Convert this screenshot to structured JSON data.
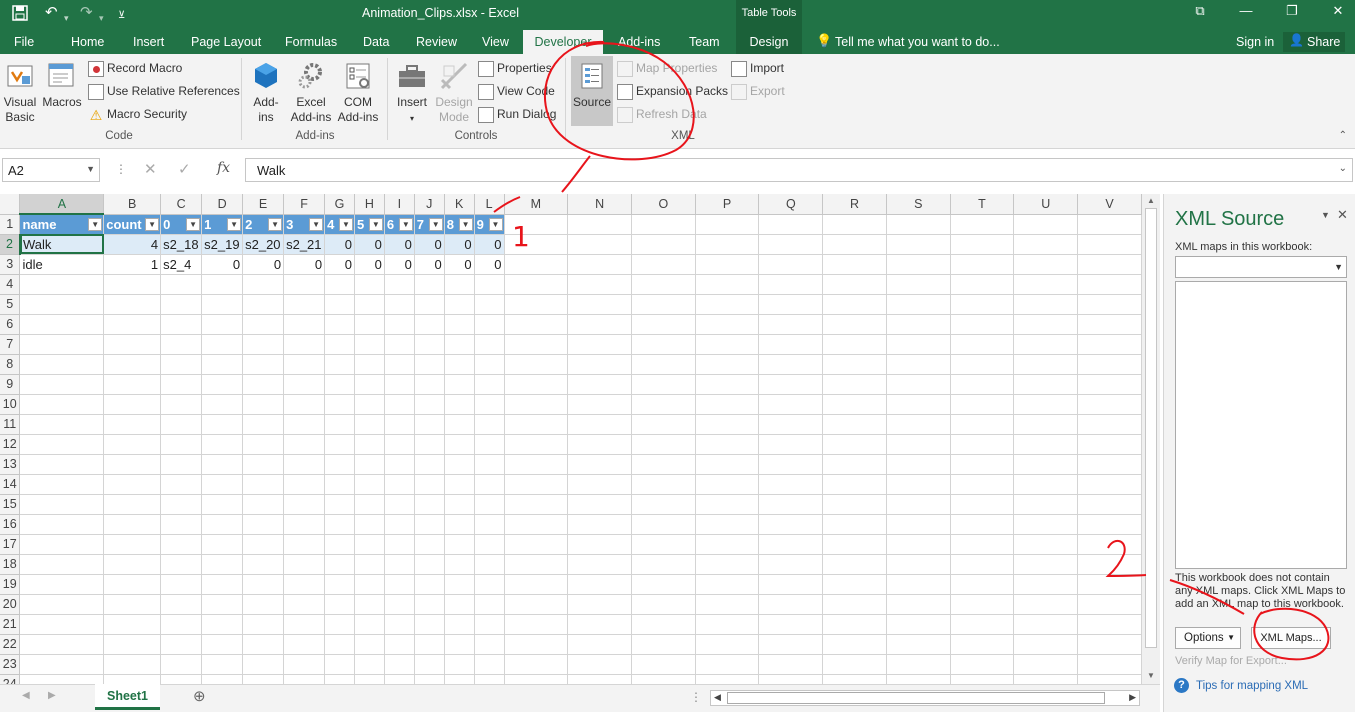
{
  "window": {
    "title": "Animation_Clips.xlsx - Excel",
    "context_group": "Table Tools",
    "signin": "Sign in",
    "share": "Share",
    "tell_me": "Tell me what you want to do..."
  },
  "tabs": [
    "File",
    "Home",
    "Insert",
    "Page Layout",
    "Formulas",
    "Data",
    "Review",
    "View",
    "Developer",
    "Add-ins",
    "Team",
    "Design"
  ],
  "ribbon": {
    "code": {
      "label": "Code",
      "visual_basic_1": "Visual",
      "visual_basic_2": "Basic",
      "macros": "Macros",
      "record_macro": "Record Macro",
      "relative_refs": "Use Relative References",
      "macro_security": "Macro Security"
    },
    "addins": {
      "label": "Add-ins",
      "addins_1": "Add-",
      "addins_2": "ins",
      "excel_addins_1": "Excel",
      "excel_addins_2": "Add-ins",
      "com_addins_1": "COM",
      "com_addins_2": "Add-ins"
    },
    "controls": {
      "label": "Controls",
      "insert": "Insert",
      "design_mode_1": "Design",
      "design_mode_2": "Mode",
      "properties": "Properties",
      "view_code": "View Code",
      "run_dialog": "Run Dialog"
    },
    "xml": {
      "label": "XML",
      "source": "Source",
      "map_properties": "Map Properties",
      "expansion_packs": "Expansion Packs",
      "refresh_data": "Refresh Data",
      "import": "Import",
      "export": "Export"
    }
  },
  "formula_bar": {
    "name_box": "A2",
    "fx": "fx",
    "value": "Walk"
  },
  "sheet": {
    "columns": [
      "A",
      "B",
      "C",
      "D",
      "E",
      "F",
      "G",
      "H",
      "I",
      "J",
      "K",
      "L",
      "M",
      "N",
      "O",
      "P",
      "Q",
      "R",
      "S",
      "T",
      "U",
      "V"
    ],
    "rows": [
      "1",
      "2",
      "3",
      "4",
      "5",
      "6",
      "7",
      "8",
      "9",
      "10",
      "11",
      "12",
      "13",
      "14",
      "15",
      "16",
      "17",
      "18",
      "19",
      "20",
      "21",
      "22",
      "23",
      "24"
    ],
    "header": [
      "name",
      "count",
      "0",
      "1",
      "2",
      "3",
      "4",
      "5",
      "6",
      "7",
      "8",
      "9"
    ],
    "data": [
      [
        "Walk",
        "4",
        "s2_18",
        "s2_19",
        "s2_20",
        "s2_21",
        "0",
        "0",
        "0",
        "0",
        "0",
        "0"
      ],
      [
        "idle",
        "1",
        "s2_4",
        "0",
        "0",
        "0",
        "0",
        "0",
        "0",
        "0",
        "0",
        "0"
      ]
    ],
    "tab": "Sheet1"
  },
  "xml_pane": {
    "title": "XML Source",
    "maps_label": "XML maps in this workbook:",
    "message": "This workbook does not contain any XML maps. Click XML Maps to add an XML map to this workbook.",
    "options": "Options",
    "xml_maps": "XML Maps...",
    "verify": "Verify Map for Export...",
    "tips": "Tips for mapping XML"
  },
  "annotations": {
    "mark_1": "1",
    "mark_2": "2",
    "color": "#e8141b"
  },
  "colors": {
    "excel_green": "#217346",
    "table_header": "#5b9bd5",
    "table_band": "#ddebf7"
  }
}
